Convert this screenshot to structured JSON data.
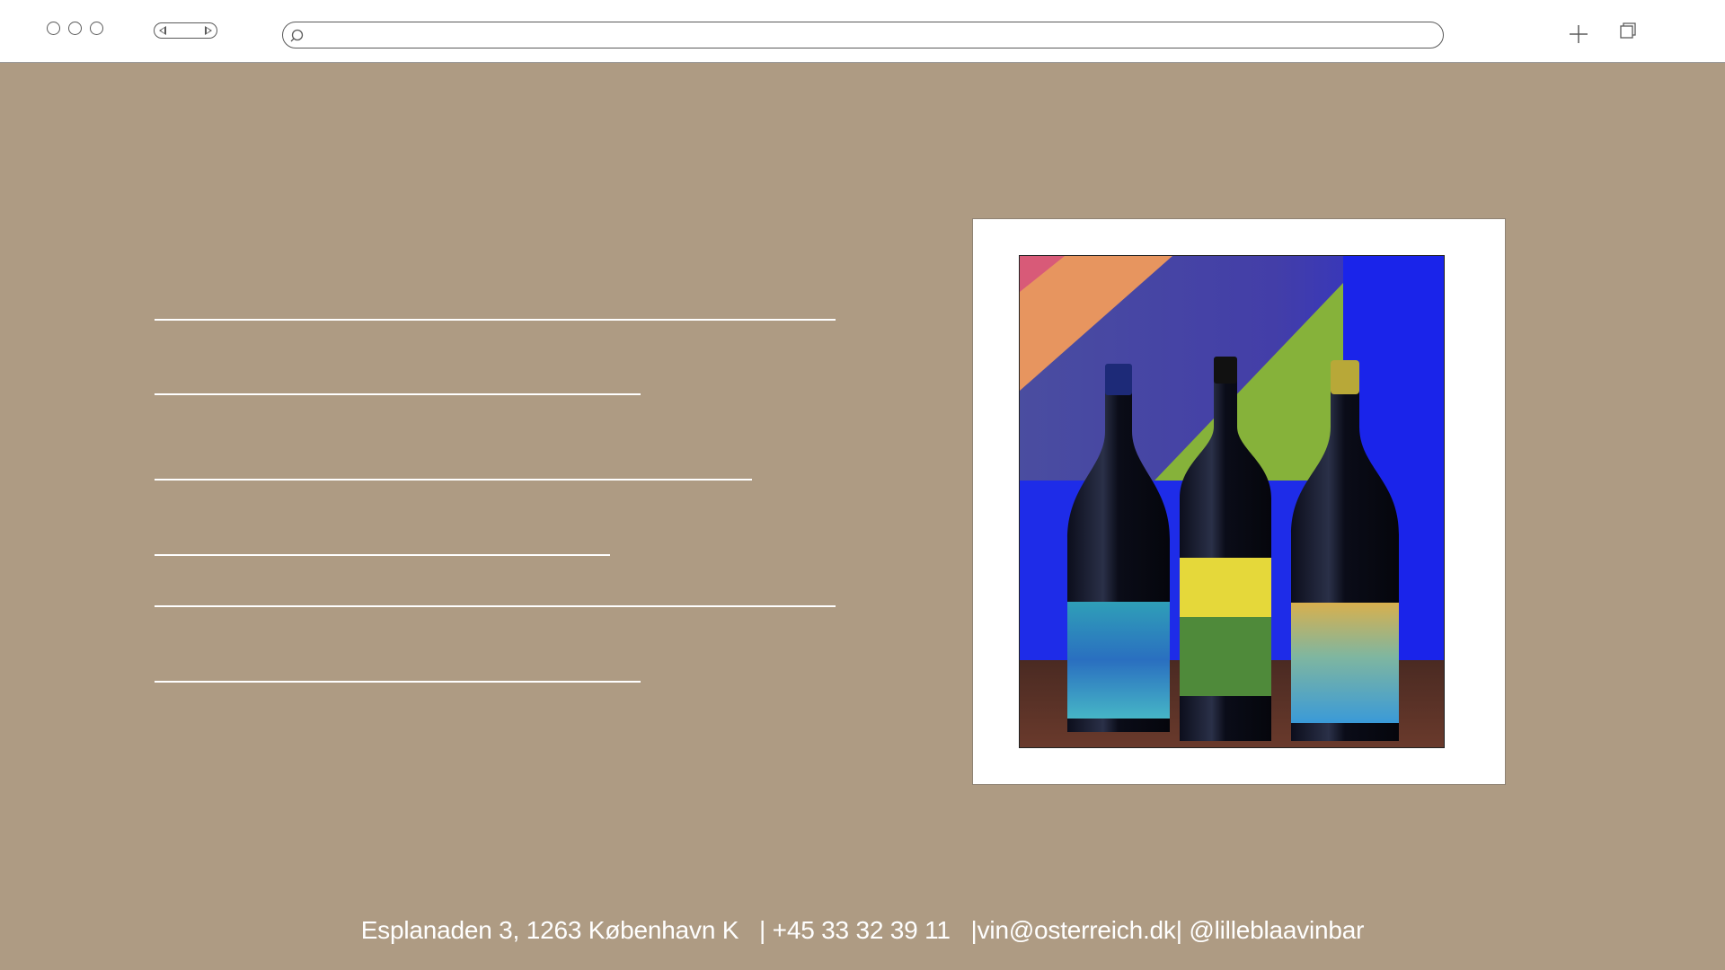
{
  "browser": {
    "url_value": "",
    "icons": {
      "window_controls": [
        "window-close-icon",
        "window-minimize-icon",
        "window-zoom-icon"
      ],
      "back": "back-arrow-icon",
      "forward": "forward-arrow-icon",
      "search": "search-icon",
      "new_tab": "plus-icon",
      "tabs": "tabs-overview-icon"
    }
  },
  "main": {
    "text_lines": 6,
    "photo": {
      "description_icon": "wine-bottles-photo"
    }
  },
  "footer": {
    "address": "Esplanaden 3, 1263 København K",
    "phone": "| +45 33 32 39 11",
    "email": "|vin@osterreich.dk|",
    "instagram": "@lilleblaavinbar"
  },
  "colors": {
    "background": "#ae9b83",
    "chrome": "#ffffff",
    "text": "#ffffff"
  }
}
